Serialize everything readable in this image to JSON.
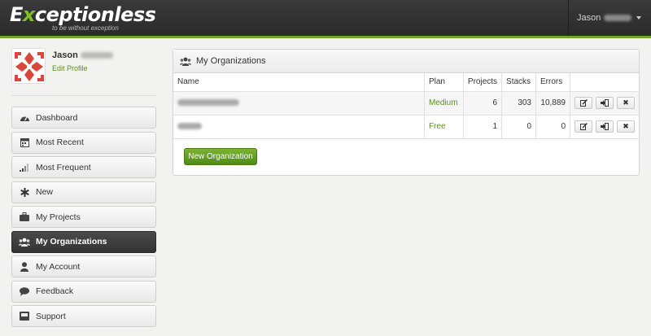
{
  "brand": {
    "name_prefix": "E",
    "name_x": "x",
    "name_rest": "ceptionless",
    "tagline": "to be without exception",
    "accent_color": "#6fa32b"
  },
  "header": {
    "user_name": "Jason"
  },
  "profile": {
    "name": "Jason",
    "edit_label": "Edit Profile"
  },
  "sidebar": {
    "items": [
      {
        "label": "Dashboard",
        "icon": "dashboard-icon"
      },
      {
        "label": "Most Recent",
        "icon": "calendar-icon"
      },
      {
        "label": "Most Frequent",
        "icon": "signal-icon"
      },
      {
        "label": "New",
        "icon": "asterisk-icon"
      },
      {
        "label": "My Projects",
        "icon": "briefcase-icon"
      },
      {
        "label": "My Organizations",
        "icon": "group-icon",
        "active": true
      },
      {
        "label": "My Account",
        "icon": "user-icon"
      },
      {
        "label": "Feedback",
        "icon": "comment-icon"
      },
      {
        "label": "Support",
        "icon": "inbox-icon"
      }
    ]
  },
  "main": {
    "panel_title": "My Organizations",
    "columns": [
      "Name",
      "Plan",
      "Projects",
      "Stacks",
      "Errors"
    ],
    "rows": [
      {
        "name": "",
        "plan": "Medium",
        "projects": "6",
        "stacks": "303",
        "errors": "10,889"
      },
      {
        "name": "",
        "plan": "Free",
        "projects": "1",
        "stacks": "0",
        "errors": "0"
      }
    ],
    "row_action_icons": [
      "edit-icon",
      "leave-icon",
      "delete-icon"
    ],
    "delete_glyph": "✖",
    "new_button_label": "New Organization"
  }
}
